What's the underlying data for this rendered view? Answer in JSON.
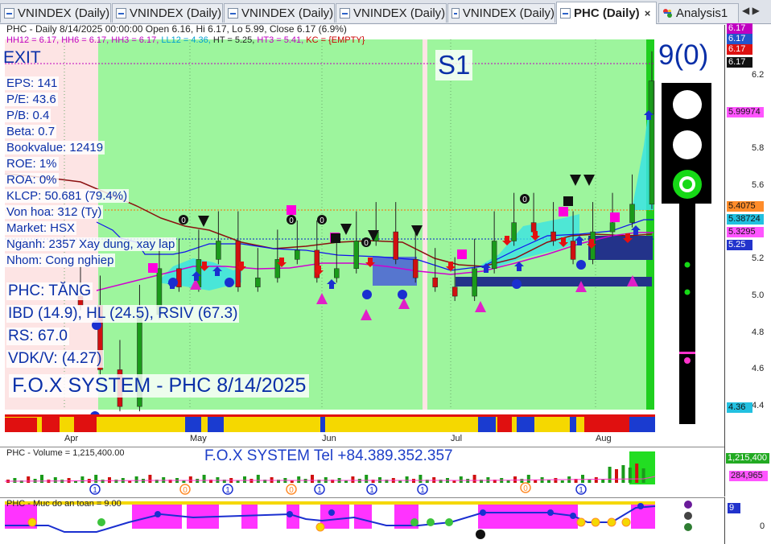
{
  "tabs": [
    {
      "label": "VNINDEX (Daily)",
      "active": false
    },
    {
      "label": "VNINDEX (Daily)",
      "active": false
    },
    {
      "label": "VNINDEX (Daily)",
      "active": false
    },
    {
      "label": "VNINDEX (Daily)",
      "active": false
    },
    {
      "label": "VNINDEX (Daily)",
      "active": false
    },
    {
      "label": "PHC (Daily)",
      "active": true
    },
    {
      "label": "Analysis1",
      "active": false
    }
  ],
  "tab_close": "×",
  "tab_nav": "◀ ▶",
  "header": {
    "line1": "PHC - Daily 8/14/2025 00:00:00 Open 6.16, Hi 6.17, Lo 5.99, Close 6.17 (6.9%)",
    "line2": [
      {
        "text": "HH12 = 6.17, ",
        "color": "#c000c0"
      },
      {
        "text": "HH6 = 6.17, ",
        "color": "#c000c0"
      },
      {
        "text": "HH3 = 6.17, ",
        "color": "#c000c0"
      },
      {
        "text": "LL12 = 4.36, ",
        "color": "#00a0d0"
      },
      {
        "text": "HT = 5.25, ",
        "color": "#222222"
      },
      {
        "text": "HT3 = 5.41, ",
        "color": "#c000c0"
      },
      {
        "text": "KC = {EMPTY}",
        "color": "#cc0000"
      }
    ]
  },
  "overlay": {
    "exit_label": "EXIT",
    "s1_label": "S1",
    "count_label": "9(0)",
    "fundamentals": [
      "EPS: 141",
      "P/E: 43.6",
      "P/B: 0.4",
      "Beta: 0.7",
      "Bookvalue: 12419",
      "ROE: 1%",
      "ROA: 0%",
      "KLCP: 50.681 (79.4%)",
      "Von hoa: 312 (Ty)",
      "Market: HSX",
      "Nganh: 2357 Xay dung, xay lap",
      "Nhom: Cong nghiep"
    ],
    "signal_lines": [
      "PHC: TĂNG",
      "IBD (14.9), HL (24.5), RSIV (67.3)",
      "RS: 67.0",
      "VDK/V:  (4.27)"
    ],
    "system_title": "F.O.X SYSTEM - PHC 8/14/2025"
  },
  "price_axis": {
    "ticks": [
      "6.2",
      "6.0",
      "5.8",
      "5.6",
      "5.4",
      "5.2",
      "5.0",
      "4.8",
      "4.6",
      "4.4"
    ],
    "tags": [
      {
        "value": "6.17",
        "color": "#c000c0"
      },
      {
        "value": "6.17",
        "color": "#2255cc"
      },
      {
        "value": "6.17",
        "color": "#dd1111"
      },
      {
        "value": "6.17",
        "color": "#111111"
      },
      {
        "value": "5.99974",
        "color": "#ff55ff"
      },
      {
        "value": "5.4075",
        "color": "#ff8c2a"
      },
      {
        "value": "5.38724",
        "color": "#22c0e0"
      },
      {
        "value": "5.3295",
        "color": "#ff55ff"
      },
      {
        "value": "5.25",
        "color": "#2233cc"
      },
      {
        "value": "4.36",
        "color": "#22c0e0"
      }
    ]
  },
  "months": [
    "Apr",
    "May",
    "Jun",
    "Jul",
    "Aug"
  ],
  "volume_pane": {
    "title": "PHC - Volume = 1,215,400.00",
    "banner": "F.O.X SYSTEM Tel +84.389.352.357",
    "tags": [
      {
        "value": "1,215,400",
        "color": "#22aa22"
      },
      {
        "value": "284,965",
        "color": "#ff55ff"
      }
    ]
  },
  "indicator_pane": {
    "title": "PHC - Muc do an toan = 9.00",
    "value_tag": "9",
    "zero_tick": "0"
  },
  "chart_data": {
    "type": "line",
    "title": "PHC - Daily",
    "last_bar": {
      "date": "8/14/2025",
      "open": 6.16,
      "high": 6.17,
      "low": 5.99,
      "close": 6.17,
      "change_pct": 6.9
    },
    "ylim": [
      4.3,
      6.3
    ],
    "series": [
      {
        "name": "Close",
        "dates": [
          "Apr",
          "May",
          "Jun",
          "Jul",
          "Aug"
        ],
        "values": [
          4.95,
          4.6,
          4.4,
          4.9,
          5.15,
          5.05,
          5.2,
          5.3,
          5.05,
          5.1,
          5.2,
          5.25,
          5.1,
          5.15,
          5.3,
          5.35,
          5.2,
          5.1,
          5.05,
          5.0,
          5.15,
          5.3,
          5.4,
          5.35,
          5.3,
          5.2,
          5.35,
          5.4,
          5.5,
          6.17
        ]
      }
    ],
    "levels": {
      "HH12": 6.17,
      "LL12": 4.36,
      "HT": 5.25,
      "HT3": 5.41
    }
  }
}
